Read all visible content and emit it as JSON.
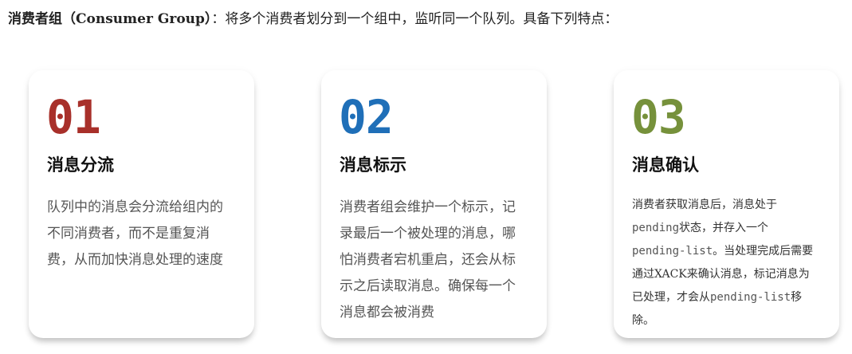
{
  "intro": {
    "term": "消费者组（Consumer Group）",
    "text": "：将多个消费者划分到一个组中，监听同一个队列。具备下列特点："
  },
  "cards": [
    {
      "number": "01",
      "color": "#A8302A",
      "title": "消息分流",
      "description": "队列中的消息会分流给组内的不同消费者，而不是重复消费，从而加快消息处理的速度"
    },
    {
      "number": "02",
      "color": "#1F6FB8",
      "title": "消息标示",
      "description": "消费者组会维护一个标示，记录最后一个被处理的消息，哪怕消费者宕机重启，还会从标示之后读取消息。确保每一个消息都会被消费"
    },
    {
      "number": "03",
      "color": "#76913B",
      "title": "消息确认",
      "description_parts": [
        "消费者获取消息后，消息处于",
        "pending",
        "状态，并存入一个",
        "pending-list",
        "。当处理完成后需要通过XACK来确认消息，标记消息为已处理，才会从",
        "pending-list",
        "移除。"
      ]
    }
  ]
}
